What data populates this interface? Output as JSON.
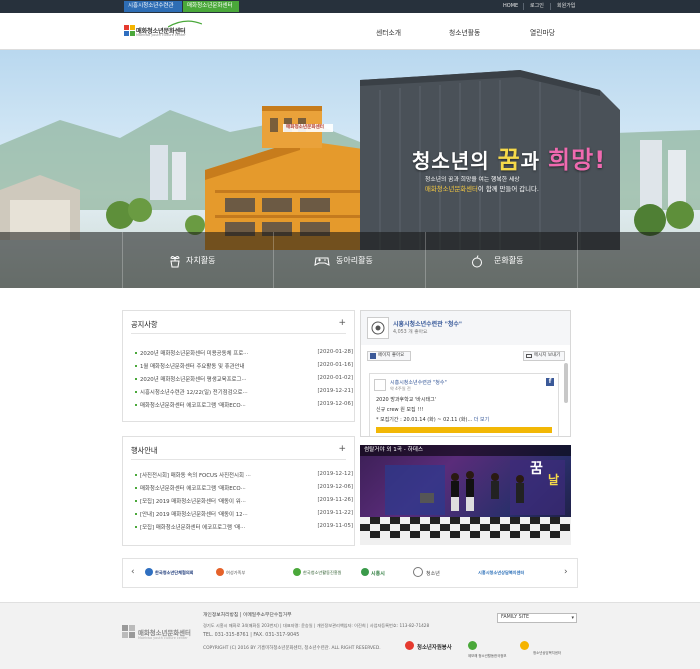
{
  "topbar": {
    "site_tabs": [
      "시흥시청소년수련관",
      "매화청소년문화센터"
    ],
    "links": [
      "HOME",
      "로그인",
      "회원가입"
    ]
  },
  "header": {
    "logo_name": "매화청소년문화센터",
    "logo_sub": "Maehwa youth culture center",
    "nav": [
      "센터소개",
      "청소년활동",
      "열린마당"
    ]
  },
  "hero": {
    "title_pre": "청소년의 ",
    "title_kkum": "꿈",
    "title_mid": "과 ",
    "title_hope": "희망!",
    "line1": "청소년의 꿈과 희망을 여는 행복한 세상",
    "line2_highlight": "매화청소년문화센터",
    "line2_rest": "이 함께 만들어 갑니다.",
    "building_sign": "매화청소년문화센터",
    "categories": [
      "자치활동",
      "동아리활동",
      "문화활동"
    ]
  },
  "notice": {
    "title": "공지사항",
    "more": "+",
    "items": [
      {
        "text": "2020년 매화청소년문화센터 미용공동체 프로···",
        "date": "[2020-01-28]"
      },
      {
        "text": "1월 매화청소년문화센터 주요활동 및 휴관안내",
        "date": "[2020-01-16]"
      },
      {
        "text": "2020년 매화청소년문화센터 평생교육프로그···",
        "date": "[2020-01-02]"
      },
      {
        "text": "시흥시청소년수련관 12/22(일) 전기점검으로···",
        "date": "[2019-12-21]"
      },
      {
        "text": "매화청소년문화센터 에코프로그램 '매화ECO···",
        "date": "[2019-12-06]"
      }
    ]
  },
  "events": {
    "title": "행사안내",
    "more": "+",
    "items": [
      {
        "text": "[사진전시회] 매화동 속의 FOCUS 사진전시회 ···",
        "date": "[2019-12-12]"
      },
      {
        "text": "매화청소년문화센터 에코프로그램 '매화ECO···",
        "date": "[2019-12-06]"
      },
      {
        "text": "[모집] 2019 매화청소년문화센터 '매동이 워···",
        "date": "[2019-11-26]"
      },
      {
        "text": "[안내] 2019 매화청소년문화센터 '매동이 12···",
        "date": "[2019-11-22]"
      },
      {
        "text": "[모집] 매화청소년문화센터 에코프로그램 '매···",
        "date": "[2019-11-05]"
      }
    ]
  },
  "facebook": {
    "page_name": "시흥시청소년수련관 \"청수\"",
    "likes": "4,053 개 좋아요",
    "like_btn": "페이지 좋아요",
    "msg_btn": "메시지 보내기",
    "post_author": "시흥시청소년수련관 \"청수\"",
    "post_time": "약 4주일 전",
    "post_lines": [
      "2020 방과후학교 '바시태그'",
      "신규 crew 원 모집 !!!",
      "* 모집기간 : 20.01.14 (화) ~ 02.11 (화)..."
    ],
    "more_link": "더 보기"
  },
  "video": {
    "title": "썸탈거야 외 1곡 - 하데스",
    "badges": [
      "꿈",
      "날"
    ]
  },
  "partners": [
    "한국청소년단체협의회",
    "여성가족부",
    "한국청소년활동진흥원",
    "시흥시",
    "청소년",
    "시흥시청소년상담복지센터"
  ],
  "footer": {
    "logo_name": "매화청소년문화센터",
    "logo_sub": "Maehwa youth culture center",
    "links": "개인정보처리방침 | 이메일주소무단수집거부",
    "address": "경기도 시흥시 매화로 34(매화동 203번지) | 대표자명: 윤승일 | 개인정보관리책임자: 이진희 | 사업자등록번호: 113-82-71428",
    "phone": "TEL. 031-315-8761  |  FAX. 031-317-9045",
    "copyright": "COPYRIGHT (C) 2016 BY 기흥미하청소년문화센터, 청소년수련관. ALL RIGHT RESERVED.",
    "family_site": "FAMILY SITE",
    "orgs": [
      "청소년자원봉사",
      "제보해 청소년활동한국정보",
      "청소년상담복지센터"
    ]
  },
  "colors": {
    "topbar": "#27313c",
    "tab_blue": "#2e6db4",
    "tab_green": "#4aa83a",
    "hero_highlight": "#f5c942",
    "hope_pink": "#f06ab0"
  }
}
